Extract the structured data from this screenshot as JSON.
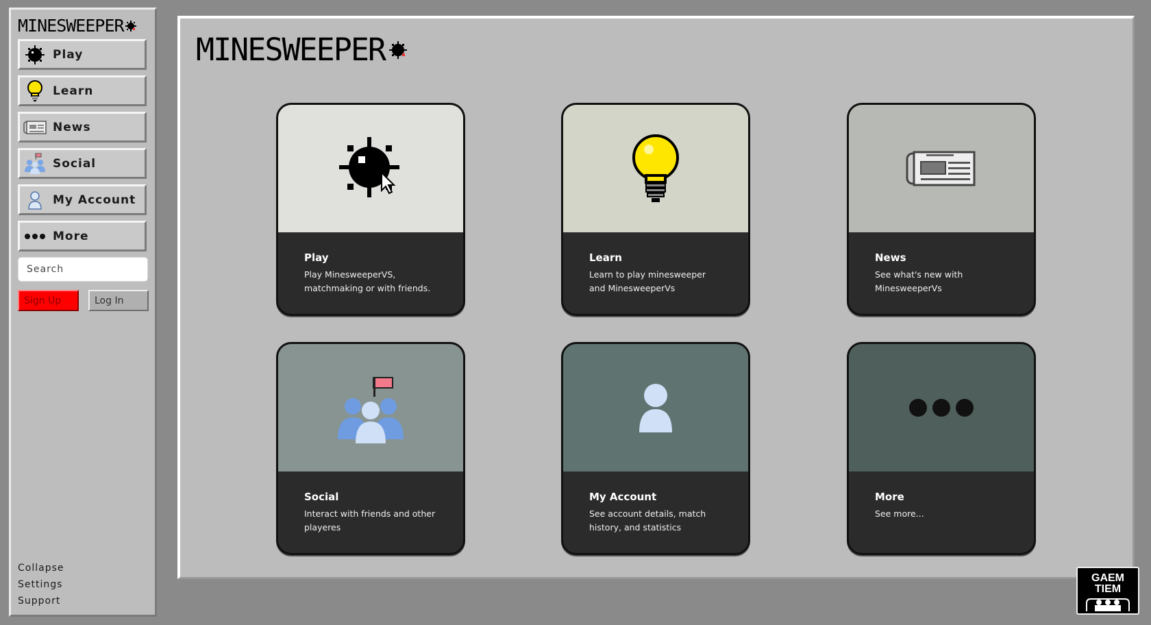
{
  "app": {
    "brand": "MINESWEEPER"
  },
  "sidebar": {
    "items": [
      {
        "label": "Play",
        "icon": "mine-icon"
      },
      {
        "label": "Learn",
        "icon": "lightbulb-icon"
      },
      {
        "label": "News",
        "icon": "newspaper-icon"
      },
      {
        "label": "Social",
        "icon": "people-icon"
      },
      {
        "label": "My Account",
        "icon": "user-icon"
      },
      {
        "label": "More",
        "icon": "dots-icon"
      }
    ],
    "search_placeholder": "Search",
    "signup_label": "Sign Up",
    "login_label": "Log In",
    "footer": [
      "Collapse",
      "Settings",
      "Support"
    ]
  },
  "main": {
    "title": "MINESWEEPER",
    "cards": [
      {
        "title": "Play",
        "desc": "Play MinesweeperVS, matchmaking or with friends.",
        "icon": "mine-icon",
        "color": "#e0e1dd"
      },
      {
        "title": "Learn",
        "desc": "Learn to play minesweeper and MinesweeperVs",
        "icon": "lightbulb-icon",
        "color": "#d3d5c8"
      },
      {
        "title": "News",
        "desc": "See what's new with MinesweeperVs",
        "icon": "newspaper-icon",
        "color": "#b7bab4"
      },
      {
        "title": "Social",
        "desc": "Interact with friends and other playeres",
        "icon": "people-icon",
        "color": "#889492"
      },
      {
        "title": "My Account",
        "desc": "See account details, match history, and statistics",
        "icon": "user-icon",
        "color": "#5f7370"
      },
      {
        "title": "More",
        "desc": "See more...",
        "icon": "dots-icon",
        "color": "#4f5f5b"
      }
    ]
  },
  "logo": {
    "line1": "GAEM",
    "line2": "TIEM"
  }
}
